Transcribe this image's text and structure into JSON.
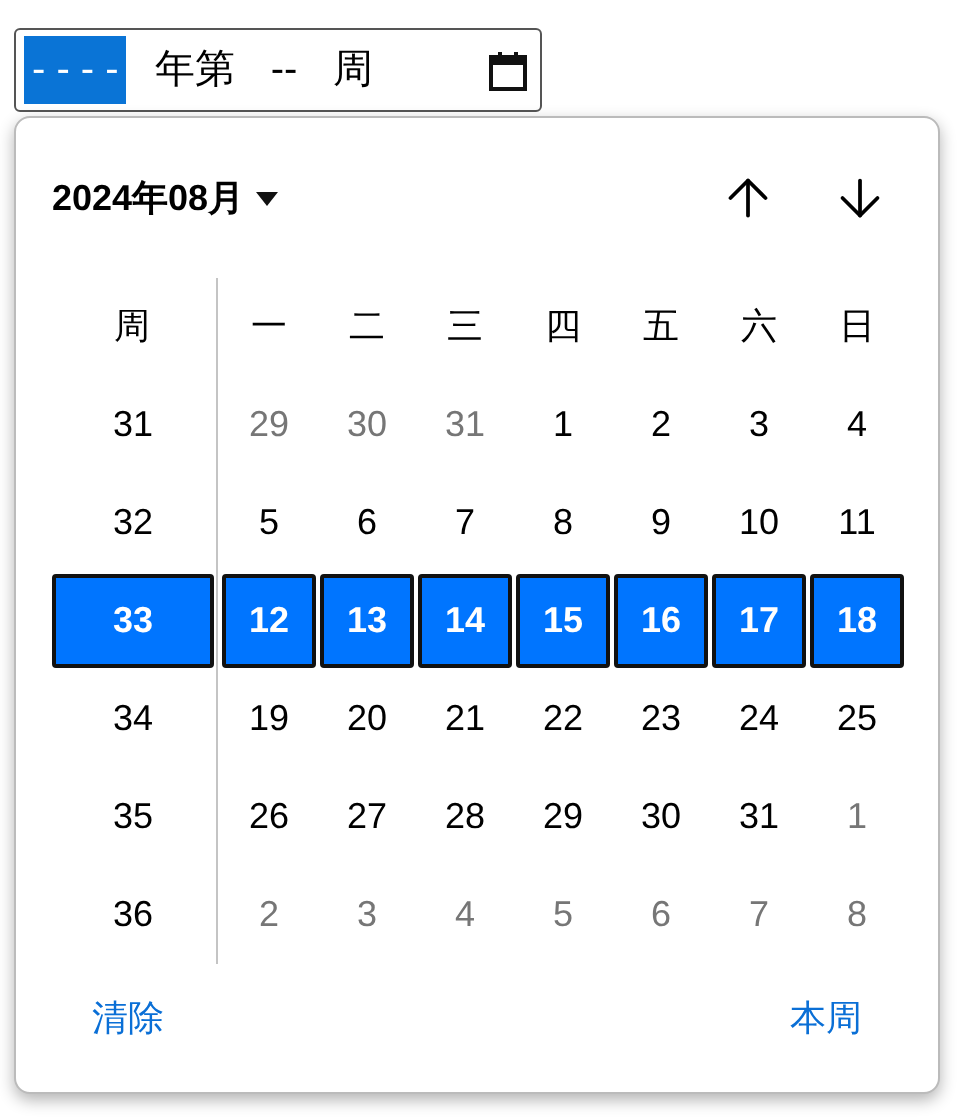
{
  "field": {
    "segments": [
      {
        "kind": "value",
        "text": "- - - -",
        "focused": true
      },
      {
        "kind": "literal",
        "text": "年第"
      },
      {
        "kind": "value",
        "text": "--",
        "focused": false
      },
      {
        "kind": "literal",
        "text": "周"
      }
    ]
  },
  "picker": {
    "month_label": "2024年08月",
    "week_header": "周",
    "weekdays": [
      "一",
      "二",
      "三",
      "四",
      "五",
      "六",
      "日"
    ],
    "rows": [
      {
        "week": "31",
        "selected": false,
        "days": [
          {
            "text": "29",
            "in_month": false
          },
          {
            "text": "30",
            "in_month": false
          },
          {
            "text": "31",
            "in_month": false
          },
          {
            "text": "1",
            "in_month": true
          },
          {
            "text": "2",
            "in_month": true
          },
          {
            "text": "3",
            "in_month": true
          },
          {
            "text": "4",
            "in_month": true
          }
        ]
      },
      {
        "week": "32",
        "selected": false,
        "days": [
          {
            "text": "5",
            "in_month": true
          },
          {
            "text": "6",
            "in_month": true
          },
          {
            "text": "7",
            "in_month": true
          },
          {
            "text": "8",
            "in_month": true
          },
          {
            "text": "9",
            "in_month": true
          },
          {
            "text": "10",
            "in_month": true
          },
          {
            "text": "11",
            "in_month": true
          }
        ]
      },
      {
        "week": "33",
        "selected": true,
        "days": [
          {
            "text": "12",
            "in_month": true
          },
          {
            "text": "13",
            "in_month": true
          },
          {
            "text": "14",
            "in_month": true
          },
          {
            "text": "15",
            "in_month": true
          },
          {
            "text": "16",
            "in_month": true
          },
          {
            "text": "17",
            "in_month": true
          },
          {
            "text": "18",
            "in_month": true
          }
        ]
      },
      {
        "week": "34",
        "selected": false,
        "days": [
          {
            "text": "19",
            "in_month": true
          },
          {
            "text": "20",
            "in_month": true
          },
          {
            "text": "21",
            "in_month": true
          },
          {
            "text": "22",
            "in_month": true
          },
          {
            "text": "23",
            "in_month": true
          },
          {
            "text": "24",
            "in_month": true
          },
          {
            "text": "25",
            "in_month": true
          }
        ]
      },
      {
        "week": "35",
        "selected": false,
        "days": [
          {
            "text": "26",
            "in_month": true
          },
          {
            "text": "27",
            "in_month": true
          },
          {
            "text": "28",
            "in_month": true
          },
          {
            "text": "29",
            "in_month": true
          },
          {
            "text": "30",
            "in_month": true
          },
          {
            "text": "31",
            "in_month": true
          },
          {
            "text": "1",
            "in_month": false
          }
        ]
      },
      {
        "week": "36",
        "selected": false,
        "days": [
          {
            "text": "2",
            "in_month": false
          },
          {
            "text": "3",
            "in_month": false
          },
          {
            "text": "4",
            "in_month": false
          },
          {
            "text": "5",
            "in_month": false
          },
          {
            "text": "6",
            "in_month": false
          },
          {
            "text": "7",
            "in_month": false
          },
          {
            "text": "8",
            "in_month": false
          }
        ]
      }
    ],
    "buttons": {
      "clear": "清除",
      "this_week": "本周"
    }
  }
}
